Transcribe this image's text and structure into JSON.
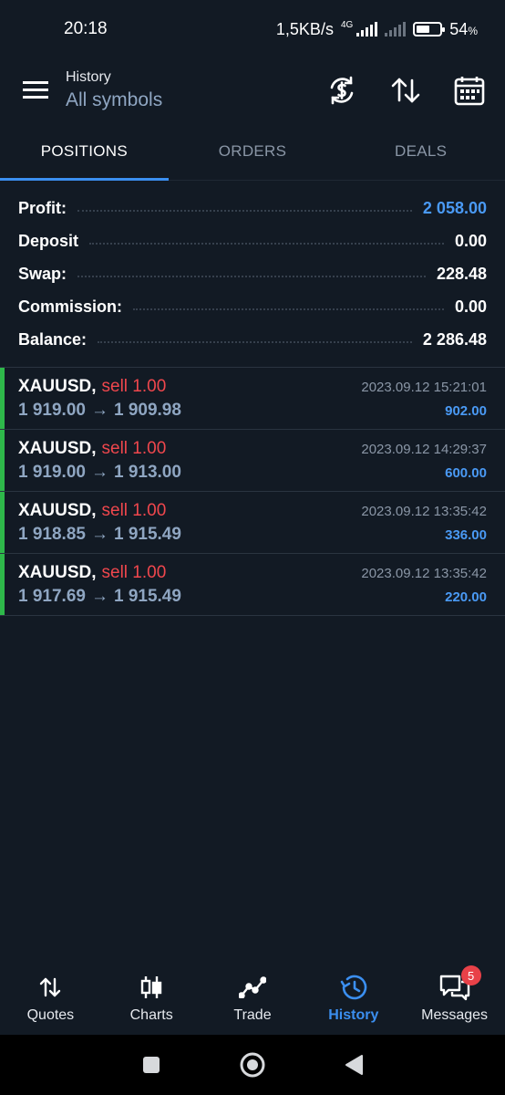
{
  "status_bar": {
    "time": "20:18",
    "speed": "1,5KB/s",
    "network": "4G",
    "battery": "54",
    "battery_unit": "%"
  },
  "toolbar": {
    "title_small": "History",
    "title_big": "All symbols",
    "icons": [
      "menu-icon",
      "currency-exchange-icon",
      "sort-icon",
      "calendar-icon"
    ]
  },
  "tabs": [
    {
      "label": "POSITIONS",
      "active": true
    },
    {
      "label": "ORDERS",
      "active": false
    },
    {
      "label": "DEALS",
      "active": false
    }
  ],
  "summary": [
    {
      "label": "Profit:",
      "value": "2 058.00",
      "accent": "#4a9af5"
    },
    {
      "label": "Deposit",
      "value": "0.00"
    },
    {
      "label": "Swap:",
      "value": "228.48"
    },
    {
      "label": "Commission:",
      "value": "0.00"
    },
    {
      "label": "Balance:",
      "value": "2 286.48"
    }
  ],
  "positions": [
    {
      "symbol": "XAUUSD,",
      "side": "sell 1.00",
      "time": "2023.09.12 15:21:01",
      "open": "1 919.00",
      "close": "1 909.98",
      "profit": "902.00"
    },
    {
      "symbol": "XAUUSD,",
      "side": "sell 1.00",
      "time": "2023.09.12 14:29:37",
      "open": "1 919.00",
      "close": "1 913.00",
      "profit": "600.00"
    },
    {
      "symbol": "XAUUSD,",
      "side": "sell 1.00",
      "time": "2023.09.12 13:35:42",
      "open": "1 918.85",
      "close": "1 915.49",
      "profit": "336.00"
    },
    {
      "symbol": "XAUUSD,",
      "side": "sell 1.00",
      "time": "2023.09.12 13:35:42",
      "open": "1 917.69",
      "close": "1 915.49",
      "profit": "220.00"
    }
  ],
  "arrow": "→",
  "bottom_nav": [
    {
      "label": "Quotes",
      "icon": "quotes-icon",
      "active": false
    },
    {
      "label": "Charts",
      "icon": "charts-icon",
      "active": false
    },
    {
      "label": "Trade",
      "icon": "trade-icon",
      "active": false
    },
    {
      "label": "History",
      "icon": "history-icon",
      "active": true
    },
    {
      "label": "Messages",
      "icon": "messages-icon",
      "active": false,
      "badge": "5"
    }
  ],
  "colors": {
    "background": "#121a24",
    "accent": "#3b8ff0",
    "sell": "#f0474d",
    "position_bar": "#2eb84a"
  }
}
